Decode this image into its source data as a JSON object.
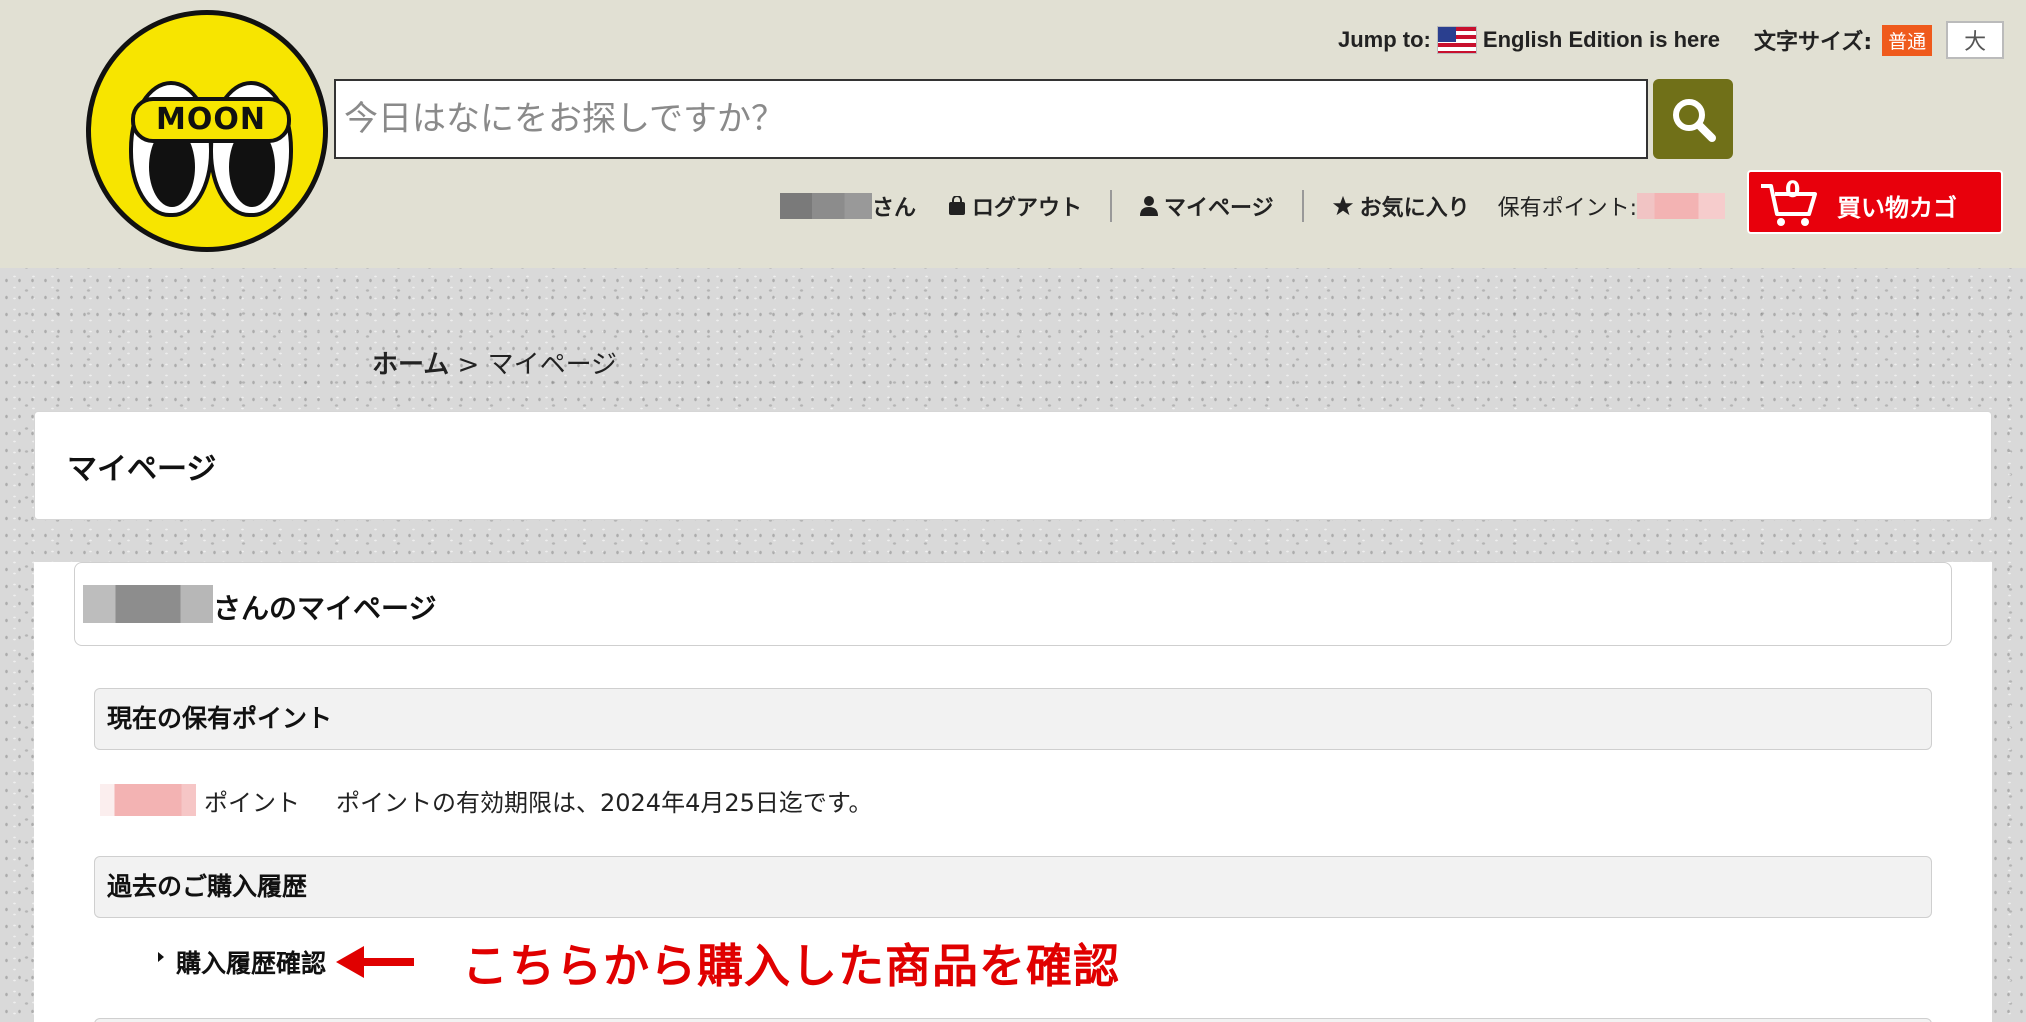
{
  "header": {
    "logo_text": "MOON",
    "jump_label": "Jump to:",
    "english_link": "English Edition is here",
    "font_size_label": "文字サイズ:",
    "font_size_normal": "普通",
    "font_size_large": "大",
    "search_placeholder": "今日はなにをお探しですか？",
    "user_suffix": "さん",
    "logout": "ログアウト",
    "mypage": "マイページ",
    "favorites": "お気に入り",
    "points_label": "保有ポイント:",
    "cart_count": "0",
    "cart_label": "買い物カゴ",
    "colors": {
      "cart": "#e8000c",
      "search_button": "#707018",
      "font_normal": "#ef5a1c"
    }
  },
  "breadcrumb": {
    "home": "ホーム",
    "separator": " > ",
    "current": "マイページ"
  },
  "page_title": "マイページ",
  "user_greeting": "さんのマイページ",
  "points_section": {
    "heading": "現在の保有ポイント",
    "unit": "ポイント",
    "expiry_text": "ポイントの有効期限は、2024年4月25日迄です。"
  },
  "history_section": {
    "heading": "過去のご購入履歴",
    "link": "購入履歴確認"
  },
  "annotation": "こちらから購入した商品を確認",
  "annotation_color": "#e00000"
}
